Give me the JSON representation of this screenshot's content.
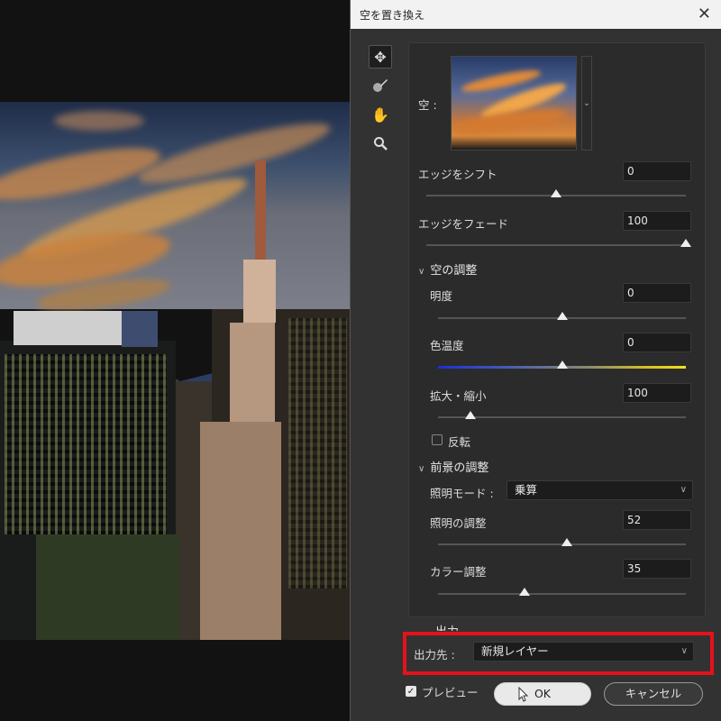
{
  "dialog": {
    "title": "空を置き換え",
    "close_icon": "close-icon"
  },
  "tools": [
    "move-icon",
    "sky-brush-icon",
    "hand-icon",
    "zoom-icon"
  ],
  "sky": {
    "label": "空 :",
    "dropdown_icon": "chevron-down-icon"
  },
  "shift_edge": {
    "label": "エッジをシフト",
    "value": "0",
    "fraction": 0.5
  },
  "fade_edge": {
    "label": "エッジをフェード",
    "value": "100",
    "fraction": 1.0
  },
  "sky_adjust": {
    "heading": "空の調整",
    "brightness": {
      "label": "明度",
      "value": "0",
      "fraction": 0.5
    },
    "temperature": {
      "label": "色温度",
      "value": "0",
      "fraction": 0.5
    },
    "scale": {
      "label": "拡大・縮小",
      "value": "100",
      "fraction": 0.13
    },
    "flip_label": "反転"
  },
  "fg_adjust": {
    "heading": "前景の調整",
    "lighting_mode_label": "照明モード :",
    "lighting_mode_value": "乗算",
    "lighting_adjust": {
      "label": "照明の調整",
      "value": "52",
      "fraction": 0.52
    },
    "color_adjust": {
      "label": "カラー調整",
      "value": "35",
      "fraction": 0.35
    }
  },
  "output": {
    "heading": "出力",
    "destination_label": "出力先 :",
    "destination_value": "新規レイヤー"
  },
  "preview_label": "プレビュー",
  "ok_label": "OK",
  "cancel_label": "キャンセル"
}
